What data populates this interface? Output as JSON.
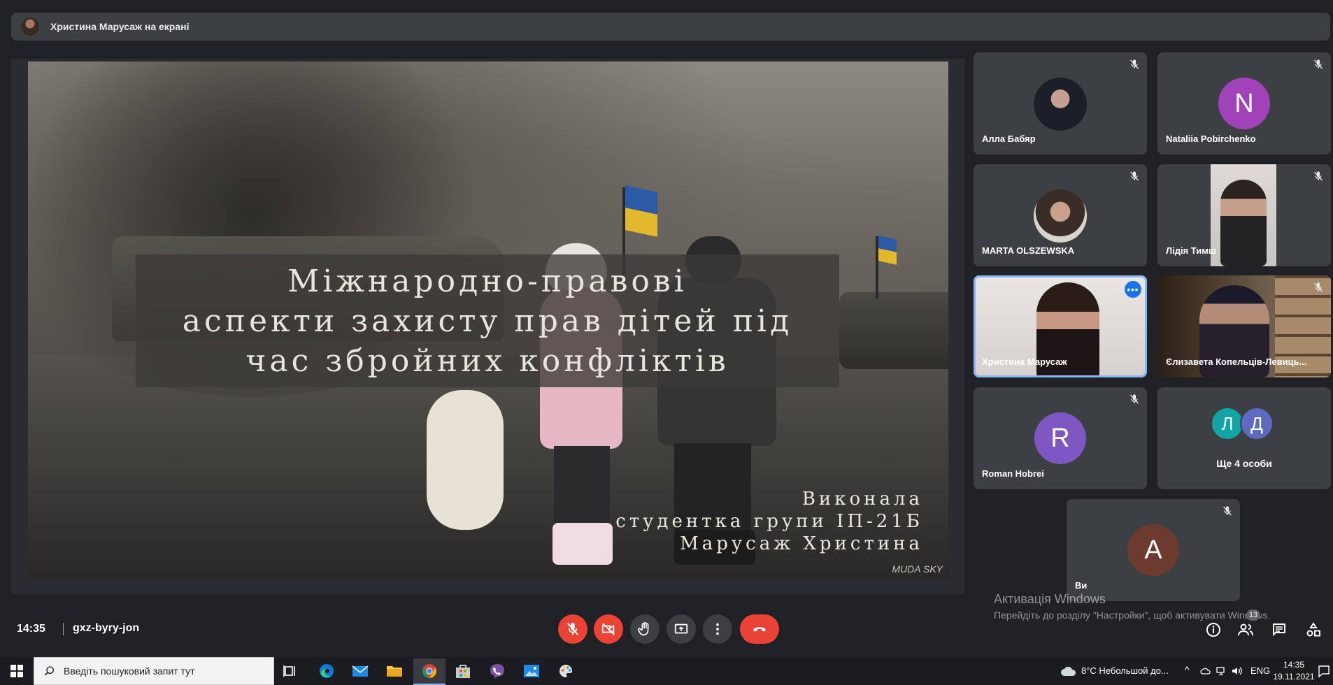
{
  "presenter_bar": {
    "label": "Христина Марусаж на екрані"
  },
  "slide": {
    "title_lines": [
      "Міжнародно-правові",
      "аспекти захисту прав дітей під",
      "час збройних конфліктів"
    ],
    "author_lines": [
      "Виконала",
      "студентка групи ІП-21Б",
      "Марусаж Христина"
    ],
    "logo_text": "MUDA SKY"
  },
  "participants": [
    {
      "name": "Алла Бабяр",
      "avatar": "photo",
      "muted": true
    },
    {
      "name": "Nataliia Pobirchenko",
      "avatar_letter": "N",
      "avatar_color": "#a142b8",
      "muted": true
    },
    {
      "name": "MARTA OLSZEWSKA",
      "avatar": "photo",
      "muted": true
    },
    {
      "name": "Лідія Тимш",
      "avatar": "video",
      "muted": true
    },
    {
      "name": "Христина Марусаж",
      "avatar": "video",
      "active": true,
      "more_label": "•••"
    },
    {
      "name": "Єлизавета Копельців-Левиць...",
      "avatar": "video",
      "muted": true
    },
    {
      "name": "Roman Hobrei",
      "avatar_letter": "R",
      "avatar_color": "#7e57c2",
      "muted": true
    },
    {
      "name": "Ще 4 особи",
      "group_letters": [
        "Л",
        "Д"
      ],
      "group_colors": [
        "#12a5a5",
        "#5c6bc0"
      ]
    },
    {
      "name": "Ви",
      "avatar_letter": "A",
      "avatar_color": "#6d3a2f",
      "muted": true
    }
  ],
  "windows_activation": {
    "title": "Активація Windows",
    "subtitle": "Перейдіть до розділу \"Настройки\", щоб активувати Windows."
  },
  "meeting": {
    "time": "14:35",
    "code": "gxz-byry-jon",
    "people_count": "13",
    "colors": {
      "danger": "#ea4335",
      "control_bg": "#3c4043",
      "accent": "#8ab4f8"
    }
  },
  "taskbar": {
    "search_placeholder": "Введіть пошуковий запит тут",
    "weather": "8°C  Небольшой до...",
    "language": "ENG",
    "clock_time": "14:35",
    "clock_date": "19.11.2021"
  },
  "icons": [
    "mic-off-icon",
    "camera-off-icon",
    "hand-icon",
    "present-icon",
    "more-vert-icon",
    "hangup-icon",
    "info-icon",
    "people-icon",
    "chat-icon",
    "activities-icon",
    "windows-start-icon",
    "search-icon",
    "task-view-icon",
    "edge-icon",
    "mail-icon",
    "file-explorer-icon",
    "chrome-icon",
    "store-icon",
    "viber-icon",
    "photos-icon",
    "paint-icon"
  ]
}
